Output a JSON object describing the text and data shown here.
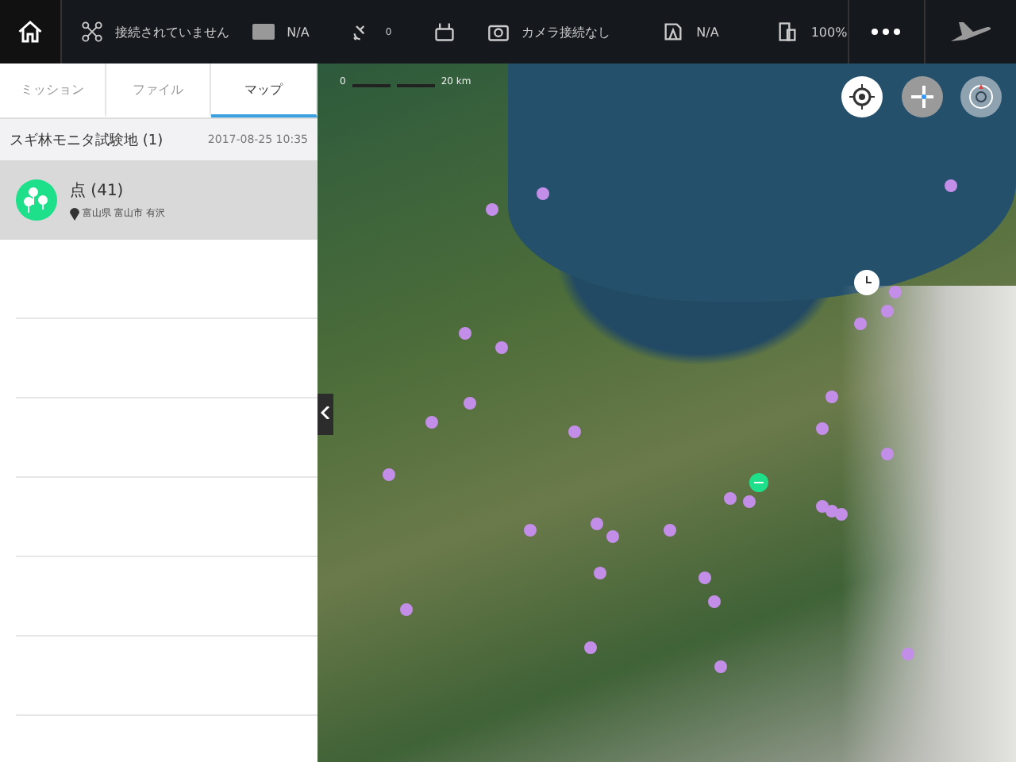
{
  "top_bar": {
    "aircraft_status": "接続されていません",
    "mode": "N/A",
    "satellites": "0",
    "camera": "カメラ接続なし",
    "signal": "N/A",
    "battery": "100%"
  },
  "tabs": [
    {
      "label": "ミッション",
      "selected": false
    },
    {
      "label": "ファイル",
      "selected": false
    },
    {
      "label": "マップ",
      "selected": true
    }
  ],
  "project": {
    "name": "スギ林モニタ試験地 (1)",
    "date": "2017-08-25 10:35"
  },
  "items": [
    {
      "title": "点 (41)",
      "location": "富山県 富山市 有沢",
      "selected": true
    }
  ],
  "map": {
    "scale_start": "0",
    "scale_label": "20 km"
  }
}
